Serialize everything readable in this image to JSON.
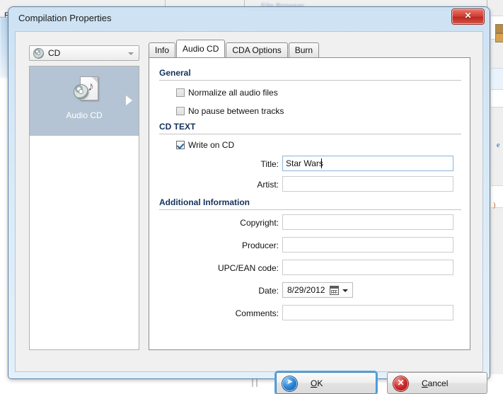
{
  "background": {
    "menu_text_left": "Fi",
    "faint_window_title": "File Browser",
    "right_glyph_e": "e",
    "right_glyph_paren": ")"
  },
  "dialog": {
    "title": "Compilation Properties",
    "close_label": "Close"
  },
  "left_pane": {
    "combo": {
      "selected": "CD",
      "icon": "cd-disc-icon",
      "arrow_icon": "chevron-down-icon"
    },
    "list": {
      "items": [
        {
          "label": "Audio CD",
          "icon": "audio-cd-document-icon",
          "selected": true,
          "arrow_icon": "chevron-right-icon"
        }
      ]
    }
  },
  "tabs": [
    {
      "label": "Info",
      "active": false
    },
    {
      "label": "Audio CD",
      "active": true
    },
    {
      "label": "CDA Options",
      "active": false
    },
    {
      "label": "Burn",
      "active": false
    }
  ],
  "sections": {
    "general": {
      "title": "General",
      "checkboxes": [
        {
          "label": "Normalize all audio files",
          "checked": false
        },
        {
          "label": "No pause between tracks",
          "checked": false
        }
      ]
    },
    "cd_text": {
      "title": "CD TEXT",
      "checkbox": {
        "label": "Write on CD",
        "checked": true
      },
      "fields": [
        {
          "label": "Title:",
          "value": "Star Wars",
          "focused": true
        },
        {
          "label": "Artist:",
          "value": "",
          "focused": false
        }
      ]
    },
    "additional_information": {
      "title": "Additional Information",
      "fields": [
        {
          "label": "Copyright:",
          "value": ""
        },
        {
          "label": "Producer:",
          "value": ""
        },
        {
          "label": "UPC/EAN code:",
          "value": ""
        }
      ],
      "date": {
        "label": "Date:",
        "value": "8/29/2012",
        "icon": "calendar-icon",
        "arrow_icon": "chevron-down-icon"
      },
      "comments": {
        "label": "Comments:",
        "value": ""
      }
    }
  },
  "footer": {
    "ok": {
      "label": "OK",
      "mnemonic": "O",
      "icon": "blue-arrow-icon",
      "focused": true
    },
    "cancel": {
      "label": "Cancel",
      "mnemonic": "C",
      "icon": "red-x-icon",
      "focused": false
    }
  },
  "colors": {
    "accent_blue": "#4ea6e8",
    "section_heading": "#13325c",
    "selection": "#b5c4d4",
    "close_red": "#d14236",
    "ok_blue": "#2a83d4",
    "cancel_red": "#cc2a2a"
  }
}
